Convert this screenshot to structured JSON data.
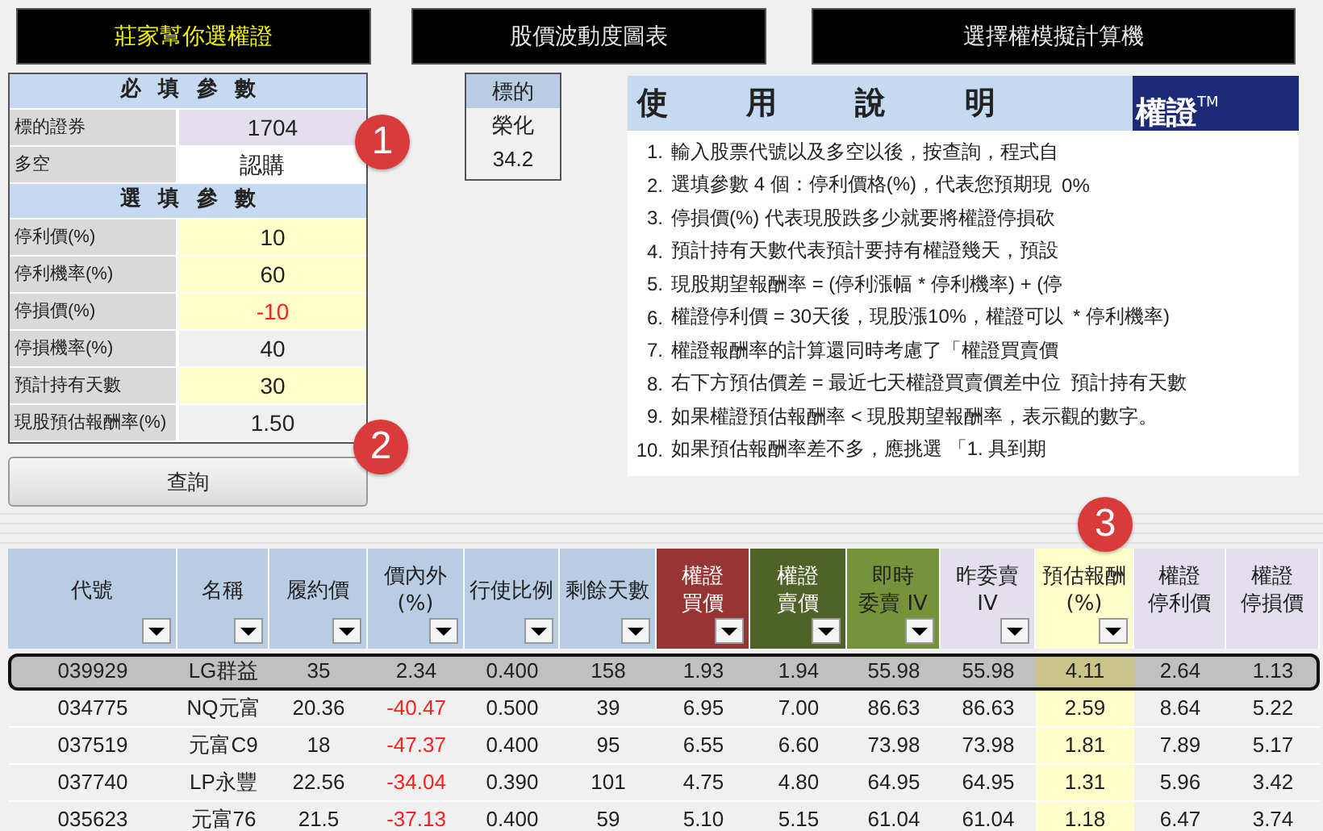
{
  "top_buttons": [
    {
      "label": "莊家幫你選權證",
      "active": true
    },
    {
      "label": "股價波動度圖表",
      "active": false
    },
    {
      "label": "選擇權模擬計算機",
      "active": false
    }
  ],
  "params": {
    "required_title": "必 填 參 數",
    "required": [
      {
        "label": "標的證券",
        "value": "1704",
        "kind": "key",
        "negative": false
      },
      {
        "label": "多空",
        "value": "認購",
        "kind": "select",
        "negative": false
      }
    ],
    "optional_title": "選 填 參 數",
    "optional": [
      {
        "label": "停利價(%)",
        "value": "10",
        "kind": "input",
        "negative": false
      },
      {
        "label": "停利機率(%)",
        "value": "60",
        "kind": "input",
        "negative": false
      },
      {
        "label": "停損價(%)",
        "value": "-10",
        "kind": "input",
        "negative": true
      },
      {
        "label": "停損機率(%)",
        "value": "40",
        "kind": "output",
        "negative": false
      },
      {
        "label": "預計持有天數",
        "value": "30",
        "kind": "input",
        "negative": false
      },
      {
        "label": "現股預估報酬率(%)",
        "value": "1.50",
        "kind": "output",
        "negative": false
      }
    ],
    "query_button": "查詢"
  },
  "underlying": {
    "header": "標的",
    "name": "榮化",
    "price": "34.2"
  },
  "guide": {
    "title": "使 用 說 明",
    "logo": "權證",
    "logo_mark": "TM",
    "lines": [
      {
        "num": "1.",
        "text": "輸入股票代號以及多空以後，按查詢，程式自"
      },
      {
        "num": "2.",
        "text": "選填參數 4 個：停利價格(%)，代表您預期現",
        "tail": "0%"
      },
      {
        "num": "3.",
        "text": "停損價(%) 代表現股跌多少就要將權證停損砍"
      },
      {
        "num": "4.",
        "text": "預計持有天數代表預計要持有權證幾天，預設"
      },
      {
        "num": "5.",
        "text": "現股期望報酬率 = (停利漲幅 * 停利機率) + (停"
      },
      {
        "num": "6.",
        "text": "權證停利價 = 30天後，現股漲10%，權證可以",
        "tail": "*  停利機率)"
      },
      {
        "num": "7.",
        "text": "權證報酬率的計算還同時考慮了「權證買賣價"
      },
      {
        "num": "8.",
        "text": "右下方預估價差 = 最近七天權證買賣價差中位",
        "tail": "預計持有天數"
      },
      {
        "num": "9.",
        "text": "如果權證預估報酬率 < 現股期望報酬率，表示觀的數字。"
      },
      {
        "num": "10.",
        "text": "如果預估報酬率差不多，應挑選 「1. 具到期"
      }
    ]
  },
  "badges": [
    "1",
    "2",
    "3"
  ],
  "table": {
    "columns": [
      {
        "label": [
          "代號"
        ],
        "color": "#b8cce4",
        "filter": true,
        "signed": false,
        "highlight": false
      },
      {
        "label": [
          "名稱"
        ],
        "color": "#b8cce4",
        "filter": true,
        "signed": false,
        "highlight": false
      },
      {
        "label": [
          "履約價"
        ],
        "color": "#b8cce4",
        "filter": true,
        "signed": false,
        "highlight": false
      },
      {
        "label": [
          "價內外",
          "(%)"
        ],
        "color": "#b8cce4",
        "filter": true,
        "signed": true,
        "highlight": false
      },
      {
        "label": [
          "行使比例"
        ],
        "color": "#b8cce4",
        "filter": true,
        "signed": false,
        "highlight": false
      },
      {
        "label": [
          "剩餘天數"
        ],
        "color": "#b8cce4",
        "filter": true,
        "signed": false,
        "highlight": false
      },
      {
        "label": [
          "權證",
          "買價"
        ],
        "color": "#963634",
        "filter": true,
        "signed": false,
        "highlight": false
      },
      {
        "label": [
          "權證",
          "賣價"
        ],
        "color": "#4f6228",
        "filter": true,
        "signed": false,
        "highlight": false
      },
      {
        "label": [
          "即時",
          "委賣 IV"
        ],
        "color": "#76933c",
        "filter": true,
        "signed": false,
        "highlight": false
      },
      {
        "label": [
          "昨委賣",
          "IV"
        ],
        "color": "#e4dfec",
        "filter": true,
        "signed": false,
        "highlight": false
      },
      {
        "label": [
          "預估報酬",
          "(%)"
        ],
        "color": "#ffffcc",
        "filter": true,
        "signed": false,
        "highlight": true
      },
      {
        "label": [
          "權證",
          "停利價"
        ],
        "color": "#e4dfec",
        "filter": false,
        "signed": false,
        "highlight": false
      },
      {
        "label": [
          "權證",
          "停損價"
        ],
        "color": "#e4dfec",
        "filter": false,
        "signed": false,
        "highlight": false
      }
    ],
    "rows": [
      {
        "selected": true,
        "negative": false,
        "cells": [
          "039929",
          "LG群益",
          "35",
          "2.34",
          "0.400",
          "158",
          "1.93",
          "1.94",
          "55.98",
          "55.98",
          "4.11",
          "2.64",
          "1.13"
        ]
      },
      {
        "selected": false,
        "negative": true,
        "cells": [
          "034775",
          "NQ元富",
          "20.36",
          "-40.47",
          "0.500",
          "39",
          "6.95",
          "7.00",
          "86.63",
          "86.63",
          "2.59",
          "8.64",
          "5.22"
        ]
      },
      {
        "selected": false,
        "negative": true,
        "cells": [
          "037519",
          "元富C9",
          "18",
          "-47.37",
          "0.400",
          "95",
          "6.55",
          "6.60",
          "73.98",
          "73.98",
          "1.81",
          "7.89",
          "5.17"
        ]
      },
      {
        "selected": false,
        "negative": true,
        "cells": [
          "037740",
          "LP永豐",
          "22.56",
          "-34.04",
          "0.390",
          "101",
          "4.75",
          "4.80",
          "64.95",
          "64.95",
          "1.31",
          "5.96",
          "3.42"
        ]
      },
      {
        "selected": false,
        "negative": true,
        "cells": [
          "035623",
          "元富76",
          "21.5",
          "-37.13",
          "0.400",
          "59",
          "5.10",
          "5.15",
          "61.04",
          "61.04",
          "1.18",
          "6.47",
          "3.74"
        ]
      }
    ]
  }
}
